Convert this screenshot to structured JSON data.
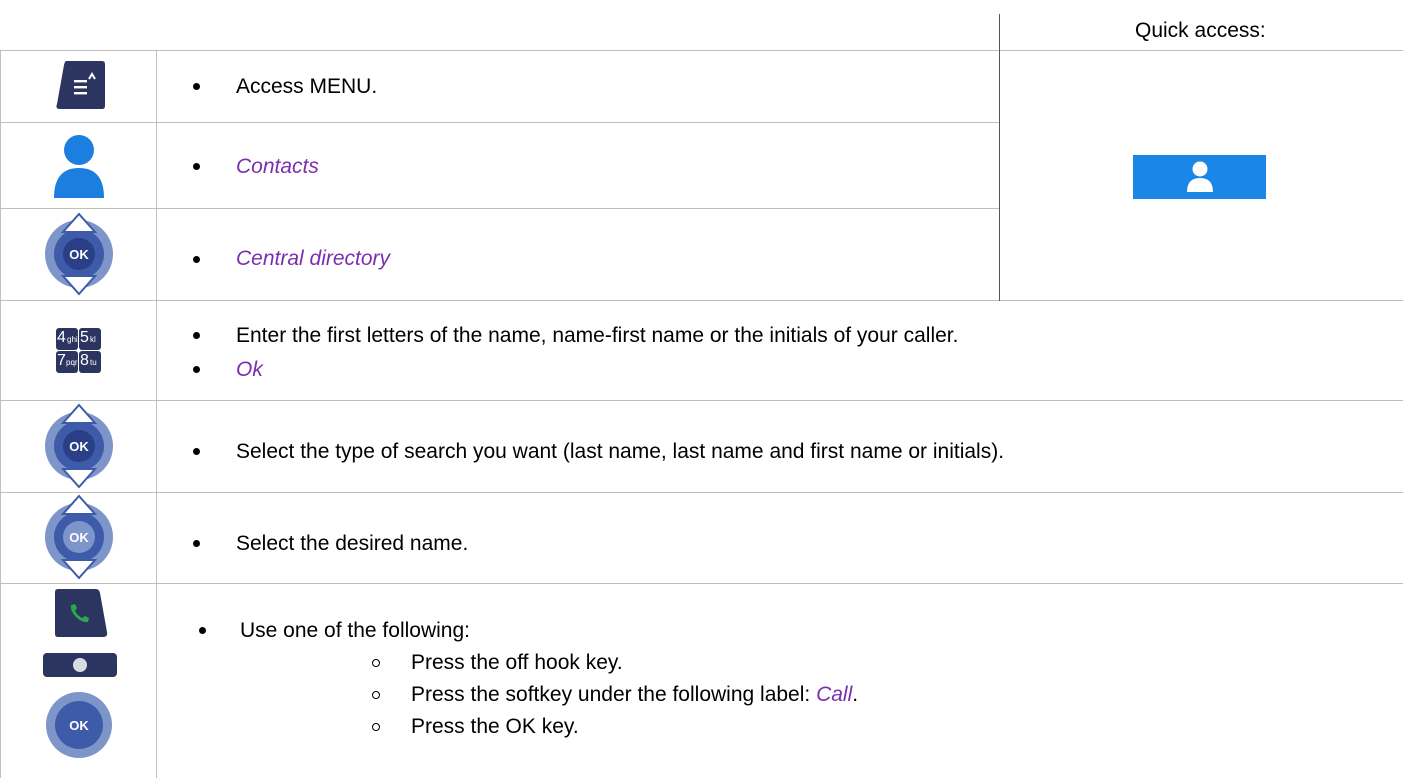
{
  "header": {
    "quick_access": "Quick access:"
  },
  "rows": [
    {
      "icon": "menu-key-icon",
      "text": "Access MENU."
    },
    {
      "icon": "contacts-icon",
      "text": "Contacts"
    },
    {
      "icon": "ok-navigator-icon",
      "text": "Central directory"
    },
    {
      "icon": "keypad-icon",
      "text": "Enter the first letters of the name, name-first name or the initials of your caller.",
      "text2": "Ok",
      "keypad": [
        "4",
        "ghi",
        "5",
        "kl",
        "7",
        "pqr",
        "8",
        "tu"
      ]
    },
    {
      "icon": "ok-navigator-icon",
      "text": "Select the type of search you want (last name, last name and first name or initials)."
    },
    {
      "icon": "ok-navigator-icon",
      "text": "Select the desired name."
    },
    {
      "icons": [
        "offhook-key-icon",
        "softkey-icon",
        "ok-key-icon"
      ],
      "text": "Use one of the following:",
      "options": [
        "Press the off hook key.",
        "Press the softkey under the following label:",
        "Press the OK key."
      ],
      "call_label": "Call",
      "period": "."
    }
  ],
  "ok_label": "OK",
  "colors": {
    "accent_purple": "#7a2fb0",
    "quick_access_blue": "#1a86e6",
    "nav_blue": "#3d5ba8",
    "key_dark": "#2b3560",
    "contact_blue": "#1c7fe0"
  }
}
